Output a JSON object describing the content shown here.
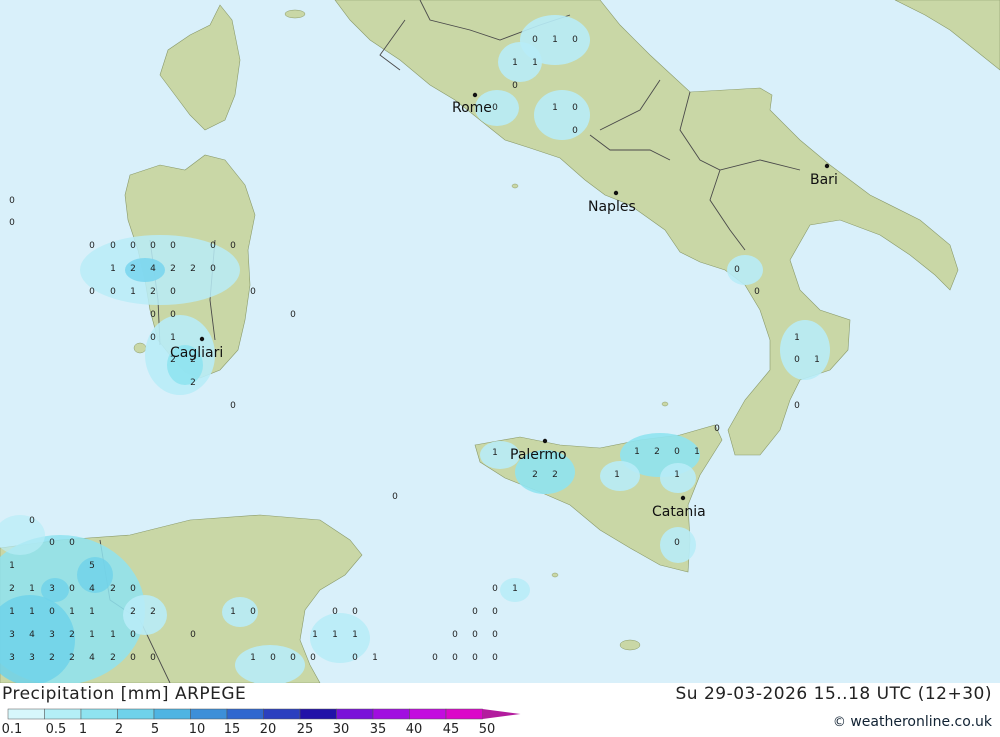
{
  "title": "Precipitation [mm] ARPEGE",
  "datetime": "Su 29-03-2026 15..18 UTC (12+30)",
  "credit": "weatheronline.co.uk",
  "credit_symbol": "©",
  "legend": {
    "labels": [
      "0.1",
      "0.5",
      "1",
      "2",
      "5",
      "10",
      "15",
      "20",
      "25",
      "30",
      "35",
      "40",
      "45",
      "50"
    ],
    "colors": [
      "#d7f7fb",
      "#b4eff7",
      "#8fe3f0",
      "#6fd2ea",
      "#4fb4e2",
      "#3d8fd8",
      "#2f67cf",
      "#2a3fbf",
      "#2111a8",
      "#7a11d9",
      "#a10ee0",
      "#c30ddf",
      "#db08c9",
      "#b31c9e"
    ]
  },
  "colors": {
    "sea": "#d9f0fa",
    "land": "#c9d7a6",
    "land_dark": "#b6c891",
    "precip_light": "#b8ecf7",
    "precip_mid": "#7cd6ee"
  },
  "cities": [
    {
      "name": "Rome"
    },
    {
      "name": "Naples"
    },
    {
      "name": "Bari"
    },
    {
      "name": "Cagliari"
    },
    {
      "name": "Palermo"
    },
    {
      "name": "Catania"
    }
  ],
  "values": [
    [
      "0",
      "1",
      "0"
    ],
    [
      "1",
      "1"
    ],
    [
      "0"
    ],
    [
      "0"
    ],
    [
      "1",
      "0"
    ],
    [
      "0"
    ],
    [
      "0"
    ],
    [
      "0"
    ],
    [
      "0",
      "0",
      "0",
      "0",
      "0",
      "0",
      "0"
    ],
    [
      "1",
      "2",
      "4",
      "2",
      "2",
      "0"
    ],
    [
      "0",
      "0",
      "1",
      "2",
      "0",
      "0"
    ],
    [
      "0",
      "0",
      "0"
    ],
    [
      "0",
      "1"
    ],
    [
      "2",
      "2"
    ],
    [
      "2"
    ],
    [
      "0"
    ],
    [
      "0"
    ],
    [
      "0"
    ],
    [
      "1"
    ],
    [
      "0",
      "1"
    ],
    [
      "0"
    ],
    [
      "0"
    ],
    [
      "1",
      "2",
      "2"
    ],
    [
      "1",
      "2",
      "0",
      "1"
    ],
    [
      "1",
      "1"
    ],
    [
      "0"
    ],
    [
      "0"
    ],
    [
      "0"
    ],
    [
      "0",
      "0"
    ],
    [
      "1"
    ],
    [
      "5"
    ],
    [
      "2",
      "1",
      "3",
      "0",
      "4",
      "2",
      "0"
    ],
    [
      "1",
      "1",
      "0",
      "1",
      "1",
      "2",
      "2"
    ],
    [
      "1",
      "0"
    ],
    [
      "0",
      "0"
    ],
    [
      "0",
      "1"
    ],
    [
      "0",
      "0"
    ],
    [
      "3",
      "4",
      "3",
      "2",
      "1",
      "1",
      "0"
    ],
    [
      "0"
    ],
    [
      "1",
      "1",
      "1"
    ],
    [
      "0",
      "0",
      "0"
    ],
    [
      "3",
      "3",
      "2",
      "2",
      "4",
      "2",
      "0",
      "0"
    ],
    [
      "1",
      "0",
      "0",
      "0"
    ],
    [
      "0",
      "1"
    ],
    [
      "0",
      "0",
      "0",
      "0"
    ]
  ]
}
